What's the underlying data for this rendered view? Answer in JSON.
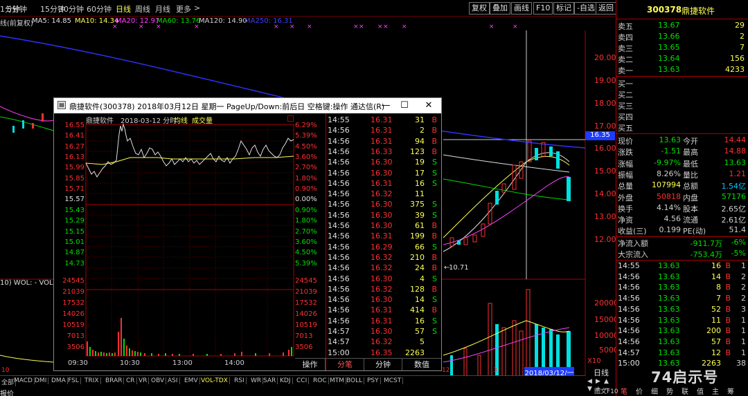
{
  "periods": [
    "1分钟",
    "5分钟",
    "15分钟",
    "30分钟",
    "60分钟",
    "日线",
    "周线",
    "月线",
    "更多"
  ],
  "period_active": "日线",
  "more_arrow": ">",
  "toolbar_buttons": [
    "复权",
    "叠加",
    "画线",
    "F10",
    "标记",
    "-自选",
    "返回"
  ],
  "ma_header": {
    "label": "线(前复权)",
    "ma5": "MA5: 14.85",
    "ma10": "MA10: 14.34",
    "ma20": "MA20: 12.97",
    "ma60": "MA60: 13.76",
    "ma120": "MA120: 14.90",
    "ma250": "MA250: 16.31",
    "marks": [
      "×",
      "×",
      "×",
      "×",
      "×",
      "×",
      "×",
      "×",
      "×",
      "×",
      "×",
      "×",
      "×",
      "×"
    ]
  },
  "price_axis": [
    "20.00",
    "19.00",
    "18.00",
    "17.00",
    "16.00",
    "15.00",
    "14.00",
    "13.00",
    "12.00"
  ],
  "highlight_price": "16.35",
  "low_marker": "10.71",
  "vol_axis": [
    "20000",
    "15000",
    "10000",
    "5000"
  ],
  "vol_unit": "X10",
  "vol_label": "10) WOL: -   VOL",
  "date_box": "2018/03/12/一",
  "date_ticks": [
    "10",
    "11",
    "12",
    "3"
  ],
  "left_bottom_label": "报价",
  "nav_day": "日线",
  "nav_arrows": [
    "◀",
    "▶",
    "▲",
    "▼",
    "+",
    "−"
  ],
  "indicators": [
    "全部",
    "MACD",
    "DMI",
    "DMA",
    "FSL",
    "TRIX",
    "BRAR",
    "CR",
    "VR",
    "OBV",
    "ASI",
    "EMV",
    "VOL-TDX",
    "RSI",
    "WR",
    "SAR",
    "KDJ",
    "CCI",
    "ROC",
    "MTM",
    "BOLL",
    "PSY",
    "MCST"
  ],
  "indicator_active": "VOL-TDX",
  "right_panel": {
    "code": "300378",
    "name": "鼎捷软件",
    "sells": [
      {
        "label": "卖五",
        "price": "13.67",
        "vol": "29"
      },
      {
        "label": "卖四",
        "price": "13.66",
        "vol": "2"
      },
      {
        "label": "卖三",
        "price": "13.65",
        "vol": "7"
      },
      {
        "label": "卖二",
        "price": "13.64",
        "vol": "156"
      },
      {
        "label": "卖一",
        "price": "13.63",
        "vol": "4233"
      }
    ],
    "buys": [
      "买一",
      "买二",
      "买三",
      "买四",
      "买五"
    ],
    "stats": [
      {
        "l1": "现价",
        "v1": "13.63",
        "l2": "今开",
        "v2": "14.44"
      },
      {
        "l1": "涨跌",
        "v1": "-1.51",
        "l2": "最高",
        "v2": "14.88"
      },
      {
        "l1": "涨幅",
        "v1": "-9.97%",
        "l2": "最低",
        "v2": "13.63"
      },
      {
        "l1": "振幅",
        "v1": "8.26%",
        "l2": "量比",
        "v2": "1.21"
      },
      {
        "l1": "总量",
        "v1": "107994",
        "l2": "总额",
        "v2": "1.54亿"
      },
      {
        "l1": "外盘",
        "v1": "50818",
        "l2": "内盘",
        "v2": "57176"
      },
      {
        "l1": "换手",
        "v1": "4.14%",
        "l2": "股本",
        "v2": "2.65亿"
      },
      {
        "l1": "净资",
        "v1": "4.56",
        "l2": "流通",
        "v2": "2.61亿"
      },
      {
        "l1": "收益(三)",
        "v1": "0.199",
        "l2": "PE(动)",
        "v2": "51.4"
      }
    ],
    "flows": [
      {
        "l": "净流入额",
        "v": "-911.7万",
        "p": "-6%"
      },
      {
        "l": "大宗流入",
        "v": "-753.4万",
        "p": "-5%"
      }
    ],
    "trades": [
      {
        "t": "14:55",
        "p": "13.63",
        "v": "16",
        "d": "B",
        "n": "1"
      },
      {
        "t": "14:56",
        "p": "13.63",
        "v": "14",
        "d": "B",
        "n": "2"
      },
      {
        "t": "14:56",
        "p": "13.63",
        "v": "8",
        "d": "B",
        "n": "2"
      },
      {
        "t": "14:56",
        "p": "13.63",
        "v": "7",
        "d": "B",
        "n": "2"
      },
      {
        "t": "14:56",
        "p": "13.63",
        "v": "52",
        "d": "B",
        "n": "3"
      },
      {
        "t": "14:56",
        "p": "13.63",
        "v": "11",
        "d": "B",
        "n": "1"
      },
      {
        "t": "14:56",
        "p": "13.63",
        "v": "200",
        "d": "B",
        "n": "1"
      },
      {
        "t": "14:56",
        "p": "13.63",
        "v": "57",
        "d": "B",
        "n": "1"
      },
      {
        "t": "14:57",
        "p": "13.63",
        "v": "12",
        "d": "B",
        "n": "1"
      },
      {
        "t": "15:00",
        "p": "13.63",
        "v": "2263",
        "d": "",
        "n": "38"
      }
    ],
    "bottom_tabs": [
      "笔",
      "价",
      "细",
      "势",
      "联",
      "值",
      "主",
      "筹"
    ],
    "bottom_label": "图文F10"
  },
  "popup": {
    "title": "鼎捷软件(300378) 2018年03月12日 星期一 PageUp/Down:前后日 空格键:操作 通达信(R)",
    "header_name": "鼎捷软件",
    "header_date": "2018-03-12 分时",
    "header_avg": "均线",
    "header_vol": "成交量",
    "price_labels": [
      "16.55",
      "16.41",
      "16.27",
      "16.13",
      "15.99",
      "15.85",
      "15.71",
      "15.57",
      "15.43",
      "15.29",
      "15.15",
      "15.01",
      "14.87",
      "14.73"
    ],
    "pct_labels": [
      "6.29%",
      "5.39%",
      "4.50%",
      "3.60%",
      "2.70%",
      "1.80%",
      "0.90%",
      "0.00%",
      "0.90%",
      "1.80%",
      "2.70%",
      "3.60%",
      "4.50%",
      "5.39%"
    ],
    "vol_labels": [
      "24545",
      "21039",
      "17532",
      "14026",
      "10519",
      "7013",
      "3506"
    ],
    "time_labels": [
      "09:30",
      "10:30",
      "13:00",
      "14:00"
    ],
    "ticks": [
      {
        "t": "14:55",
        "p": "16.31",
        "v": "31",
        "d": "B"
      },
      {
        "t": "14:56",
        "p": "16.31",
        "v": "2",
        "d": "B"
      },
      {
        "t": "14:56",
        "p": "16.31",
        "v": "94",
        "d": "B"
      },
      {
        "t": "14:56",
        "p": "16.33",
        "v": "123",
        "d": "B"
      },
      {
        "t": "14:56",
        "p": "16.30",
        "v": "19",
        "d": "S"
      },
      {
        "t": "14:56",
        "p": "16.30",
        "v": "17",
        "d": "S"
      },
      {
        "t": "14:56",
        "p": "16.31",
        "v": "16",
        "d": "S"
      },
      {
        "t": "14:56",
        "p": "16.32",
        "v": "11",
        "d": ""
      },
      {
        "t": "14:56",
        "p": "16.30",
        "v": "375",
        "d": "S"
      },
      {
        "t": "14:56",
        "p": "16.30",
        "v": "39",
        "d": "S"
      },
      {
        "t": "14:56",
        "p": "16.30",
        "v": "61",
        "d": "B"
      },
      {
        "t": "14:56",
        "p": "16.31",
        "v": "199",
        "d": "B"
      },
      {
        "t": "14:56",
        "p": "16.29",
        "v": "66",
        "d": "S"
      },
      {
        "t": "14:56",
        "p": "16.32",
        "v": "210",
        "d": "B"
      },
      {
        "t": "14:56",
        "p": "16.32",
        "v": "24",
        "d": "B"
      },
      {
        "t": "14:56",
        "p": "16.30",
        "v": "4",
        "d": "S"
      },
      {
        "t": "14:56",
        "p": "16.32",
        "v": "128",
        "d": "B"
      },
      {
        "t": "14:56",
        "p": "16.30",
        "v": "14",
        "d": "S"
      },
      {
        "t": "14:56",
        "p": "16.31",
        "v": "414",
        "d": "B"
      },
      {
        "t": "14:56",
        "p": "16.31",
        "v": "16",
        "d": "S"
      },
      {
        "t": "14:57",
        "p": "16.30",
        "v": "57",
        "d": "S"
      },
      {
        "t": "14:57",
        "p": "16.32",
        "v": "5",
        "d": ""
      },
      {
        "t": "15:00",
        "p": "16.35",
        "v": "2263",
        "d": ""
      }
    ],
    "tabs": [
      "操作",
      "分笔",
      "分钟",
      "数值"
    ],
    "tab_active": "分笔",
    "win_buttons": [
      "—",
      "☐",
      "✕"
    ]
  },
  "watermark": "74启示号",
  "colors": {
    "up": "#ff3030",
    "down": "#00e000",
    "flat": "#e0e0e0",
    "yellow": "#ffff54",
    "cyan": "#00c8ff"
  }
}
